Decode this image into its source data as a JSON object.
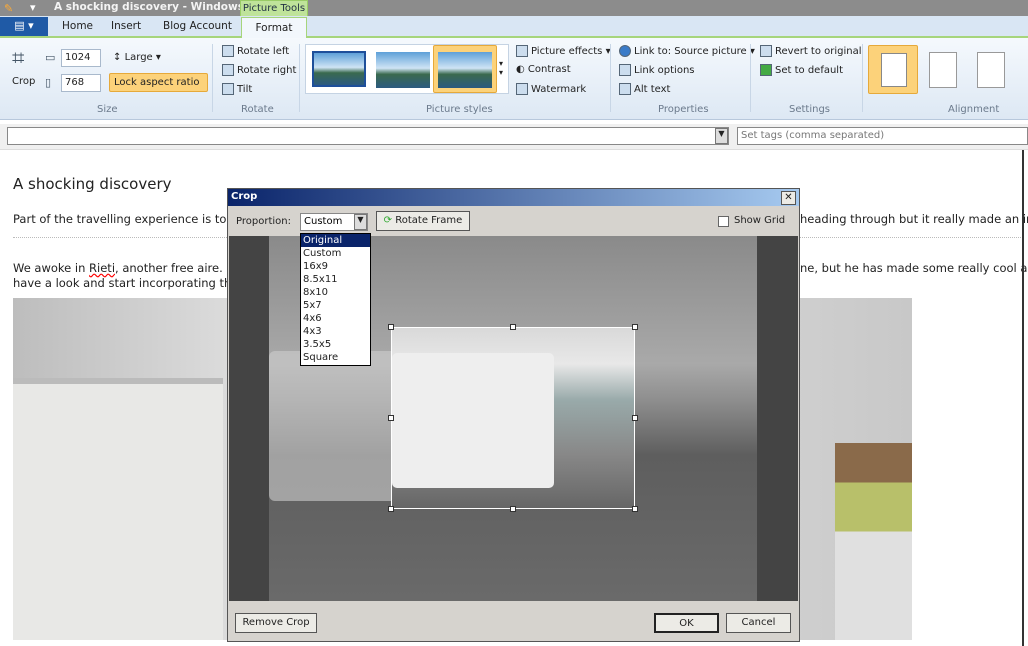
{
  "window": {
    "title": "A shocking discovery - Windows Liv...",
    "context_tab": "Picture Tools"
  },
  "tabs": [
    "Home",
    "Insert",
    "Blog Account",
    "Format"
  ],
  "ribbon": {
    "size": {
      "crop": "Crop",
      "width": "1024",
      "height": "768",
      "preset": "Large",
      "lock": "Lock aspect ratio",
      "group": "Size"
    },
    "rotate": {
      "left": "Rotate left",
      "right": "Rotate right",
      "tilt": "Tilt",
      "group": "Rotate"
    },
    "styles": {
      "effects": "Picture effects",
      "contrast": "Contrast",
      "watermark": "Watermark",
      "group": "Picture styles"
    },
    "properties": {
      "link": "Link to: Source picture",
      "link_options": "Link options",
      "alt": "Alt text",
      "group": "Properties"
    },
    "settings": {
      "revert": "Revert to original",
      "default": "Set to default",
      "group": "Settings"
    },
    "alignment": {
      "group": "Alignment"
    }
  },
  "tagbar": {
    "category_value": "",
    "tags_placeholder": "Set tags (comma separated)"
  },
  "document": {
    "title": "A shocking discovery",
    "p1_left": "Part of the travelling experience is to co",
    "p1_right": "heading through but it really made an imp",
    "p2_l1_a": "We awoke in ",
    "p2_l1_link": "Rieti",
    "p2_l1_b": ", another free aire. O",
    "p2_l2": "have a look and start incorporating ther",
    "p2_right": "ne, but he has made some really cool adap"
  },
  "crop_dialog": {
    "title": "Crop",
    "proportion_label": "Proportion:",
    "proportion_value": "Custom",
    "options": [
      "Original",
      "Custom",
      "16x9",
      "8.5x11",
      "8x10",
      "5x7",
      "4x6",
      "4x3",
      "3.5x5",
      "Square"
    ],
    "highlighted": "Original",
    "rotate_frame": "Rotate Frame",
    "show_grid": "Show Grid",
    "show_grid_checked": false,
    "remove_crop": "Remove Crop",
    "ok": "OK",
    "cancel": "Cancel"
  }
}
